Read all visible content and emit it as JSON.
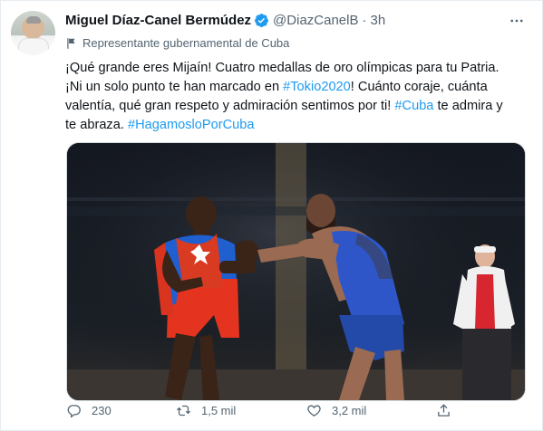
{
  "author": {
    "name": "Miguel Díaz-Canel Bermúdez",
    "handle": "@DiazCanelB",
    "separator": "·",
    "time": "3h"
  },
  "label": "Representante gubernamental de Cuba",
  "text_parts": [
    {
      "text": "¡Qué grande eres Mijaín! Cuatro medallas de oro olímpicas para tu Patria."
    },
    {
      "text": "¡Ni un solo punto te han marcado en "
    },
    {
      "text": "#Tokio2020"
    },
    {
      "text": "! Cuánto coraje, cuánta"
    },
    {
      "text": "valentía, qué gran respeto y admiración sentimos por ti! "
    },
    {
      "text": "#Cuba"
    },
    {
      "text": " te admira y"
    },
    {
      "text": "te abraza. "
    },
    {
      "text": "#HagamosloPorCuba"
    }
  ],
  "actions": {
    "replies": "230",
    "retweets": "1,5 mil",
    "likes": "3,2 mil"
  },
  "colors": {
    "accent": "#1d9bf0",
    "secondary_text": "#536471"
  },
  "icons": [
    "verified-badge-icon",
    "more-options-icon",
    "flag-icon",
    "reply-icon",
    "retweet-icon",
    "like-icon",
    "share-icon"
  ]
}
